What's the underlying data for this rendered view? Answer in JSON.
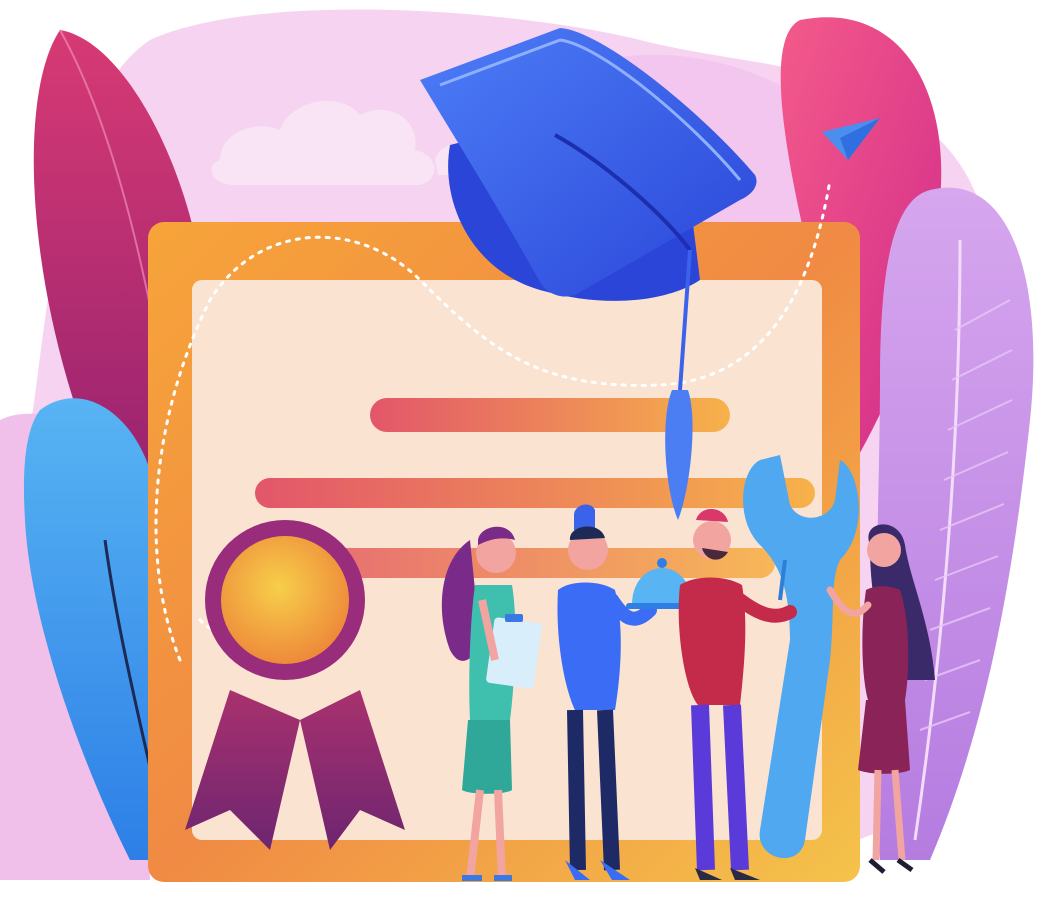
{
  "illustration": {
    "subject_icons": [
      "certificate-icon",
      "graduation-cap-icon",
      "rosette-ribbon-icon",
      "paper-plane-icon",
      "wrench-icon",
      "cloche-icon",
      "clipboard-icon"
    ],
    "people": [
      "woman-with-clipboard",
      "chef-with-cloche",
      "mechanic-with-wrench",
      "woman-presenting"
    ],
    "colors": {
      "magenta": "#c42a6b",
      "pink_bg": "#f3b8e6",
      "lavender": "#c99be8",
      "orange": "#f49a3a",
      "yellow": "#f7d24a",
      "cream": "#fbe3d2",
      "blue": "#3b6cf5",
      "cyan": "#4fa8f0",
      "purple_dark": "#6a2a7a"
    }
  }
}
